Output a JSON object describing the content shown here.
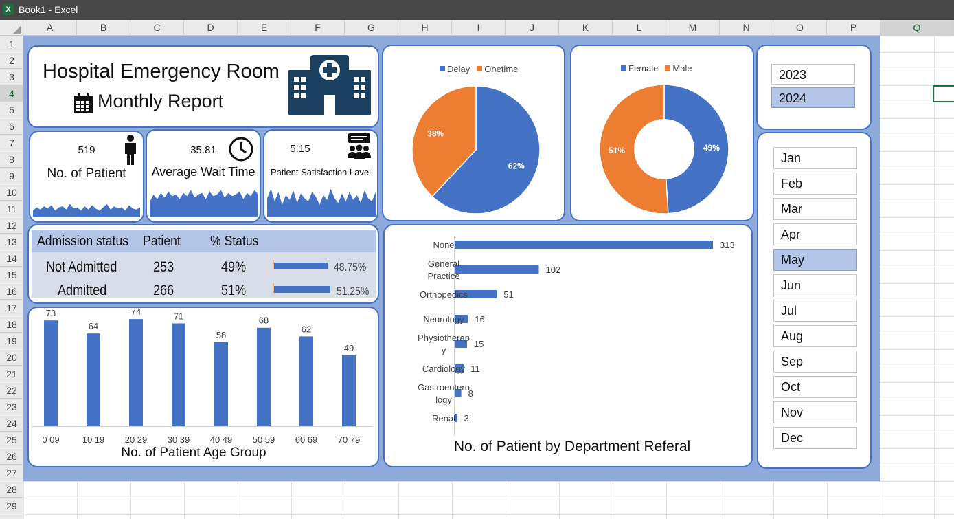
{
  "window": {
    "title": "Book1 - Excel",
    "app_icon": "excel-icon"
  },
  "columns": [
    "A",
    "B",
    "C",
    "D",
    "E",
    "F",
    "G",
    "H",
    "I",
    "J",
    "K",
    "L",
    "M",
    "N",
    "O",
    "P",
    "Q"
  ],
  "rows": [
    "1",
    "2",
    "3",
    "4",
    "5",
    "6",
    "7",
    "8",
    "9",
    "10",
    "11",
    "12",
    "13",
    "14",
    "15",
    "16",
    "17",
    "18",
    "19",
    "20",
    "21",
    "22",
    "23",
    "24",
    "25",
    "26",
    "27",
    "28",
    "29"
  ],
  "selected_cell": {
    "column": "Q",
    "row": "4"
  },
  "header": {
    "title": "Hospital Emergency Room",
    "subtitle": "Monthly Report",
    "icons": [
      "hospital-icon",
      "calendar-icon"
    ]
  },
  "kpis": [
    {
      "value": "519",
      "label": "No. of Patient",
      "icon": "person-icon",
      "spark": [
        0.3,
        0.45,
        0.35,
        0.5,
        0.4,
        0.55,
        0.3,
        0.45,
        0.5,
        0.35,
        0.6,
        0.4,
        0.45,
        0.3,
        0.5,
        0.35,
        0.55,
        0.4,
        0.3,
        0.45,
        0.6,
        0.35,
        0.5,
        0.4,
        0.45,
        0.3,
        0.55,
        0.4,
        0.35,
        0.45
      ]
    },
    {
      "value": "35.81",
      "label": "Average Wait Time",
      "icon": "clock-icon",
      "spark": [
        0.5,
        0.75,
        0.6,
        0.8,
        0.65,
        0.85,
        0.7,
        0.75,
        0.6,
        0.8,
        0.7,
        0.9,
        0.65,
        0.75,
        0.8,
        0.6,
        0.85,
        0.7,
        0.75,
        0.9,
        0.65,
        0.8,
        0.7,
        0.75,
        0.85,
        0.6,
        0.8,
        0.7,
        0.9,
        0.75
      ]
    },
    {
      "value": "5.15",
      "label": "Patient Satisfaction Lavel",
      "icon": "meeting-icon",
      "spark": [
        0.6,
        0.9,
        0.5,
        0.8,
        0.4,
        0.7,
        0.55,
        0.85,
        0.45,
        0.75,
        0.6,
        0.5,
        0.8,
        0.65,
        0.4,
        0.7,
        0.55,
        0.9,
        0.6,
        0.45,
        0.75,
        0.5,
        0.8,
        0.55,
        0.7,
        0.45,
        0.85,
        0.6,
        0.5,
        0.8
      ]
    }
  ],
  "delay_pie": {
    "type": "pie",
    "legend": [
      {
        "name": "Delay",
        "color": "#4472c4"
      },
      {
        "name": "Onetime",
        "color": "#ed7d31"
      }
    ],
    "values": [
      62,
      38
    ],
    "labels": [
      "62%",
      "38%"
    ]
  },
  "gender_donut": {
    "type": "donut",
    "legend": [
      {
        "name": "Female",
        "color": "#4472c4"
      },
      {
        "name": "Male",
        "color": "#ed7d31"
      }
    ],
    "values": [
      49,
      51
    ],
    "labels": [
      "49%",
      "51%"
    ]
  },
  "admission": {
    "headers": [
      "Admission status",
      "Patient",
      "% Status"
    ],
    "rows": [
      {
        "status": "Not Admitted",
        "patient": "253",
        "pct": "49%",
        "bar_label": "48.75%",
        "bar_fraction": 0.4875
      },
      {
        "status": "Admitted",
        "patient": "266",
        "pct": "51%",
        "bar_label": "51.25%",
        "bar_fraction": 0.5125
      }
    ]
  },
  "years": {
    "items": [
      "2023",
      "2024"
    ],
    "selected": "2024"
  },
  "months": {
    "items": [
      "Jan",
      "Feb",
      "Mar",
      "Apr",
      "May",
      "Jun",
      "Jul",
      "Aug",
      "Sep",
      "Oct",
      "Nov",
      "Dec"
    ],
    "selected": "May"
  },
  "chart_data": [
    {
      "type": "bar",
      "title": "No. of Patient Age Group",
      "categories": [
        "0  09",
        "10  19",
        "20  29",
        "30  39",
        "40  49",
        "50  59",
        "60  69",
        "70  79"
      ],
      "values": [
        73,
        64,
        74,
        71,
        58,
        68,
        62,
        49
      ],
      "ylim": [
        0,
        75
      ],
      "color": "#4472c4",
      "grid": false
    },
    {
      "type": "bar",
      "orientation": "horizontal",
      "title": "No. of Patient by Department Referal",
      "categories": [
        [
          "None"
        ],
        [
          "General",
          "Practice"
        ],
        [
          "Orthopedics"
        ],
        [
          "Neurology"
        ],
        [
          "Physiotherap",
          "y"
        ],
        [
          "Cardiology"
        ],
        [
          "Gastroentero",
          "logy"
        ],
        [
          "Renal"
        ]
      ],
      "values": [
        313,
        102,
        51,
        16,
        15,
        11,
        8,
        3
      ],
      "xlim": [
        0,
        313
      ],
      "color": "#4472c4",
      "grid": false
    },
    {
      "type": "pie",
      "categories": [
        "Delay",
        "Onetime"
      ],
      "values": [
        62,
        38
      ]
    },
    {
      "type": "pie",
      "categories": [
        "Female",
        "Male"
      ],
      "values": [
        49,
        51
      ]
    }
  ]
}
